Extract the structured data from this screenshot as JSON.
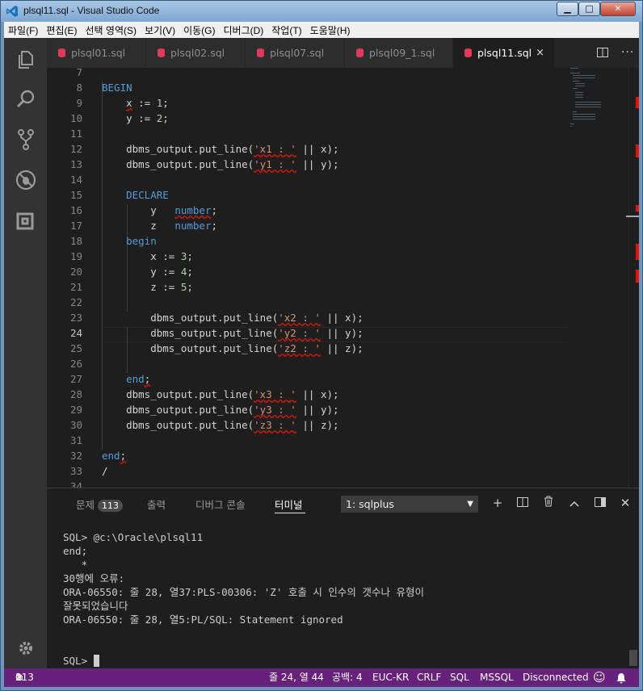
{
  "window": {
    "title": "plsql11.sql - Visual Studio Code",
    "minimize": "▁",
    "maximize": "□",
    "close": "✕"
  },
  "menu": [
    "파일(F)",
    "편집(E)",
    "선택 영역(S)",
    "보기(V)",
    "이동(G)",
    "디버그(D)",
    "작업(T)",
    "도움말(H)"
  ],
  "tabs": [
    {
      "label": "plsql01.sql"
    },
    {
      "label": "plsql02.sql"
    },
    {
      "label": "plsql07.sql"
    },
    {
      "label": "plsql09_1.sql"
    },
    {
      "label": "plsql11.sql",
      "active": true,
      "close": "×"
    }
  ],
  "editor": {
    "current_line": 24,
    "lines": [
      {
        "n": "7",
        "text": ""
      },
      {
        "n": "8",
        "text": "BEGIN"
      },
      {
        "n": "9",
        "text": "    x := 1;"
      },
      {
        "n": "10",
        "text": "    y := 2;"
      },
      {
        "n": "11",
        "text": ""
      },
      {
        "n": "12",
        "text": "    dbms_output.put_line('x1 : ' || x);"
      },
      {
        "n": "13",
        "text": "    dbms_output.put_line('y1 : ' || y);"
      },
      {
        "n": "14",
        "text": ""
      },
      {
        "n": "15",
        "text": "    DECLARE"
      },
      {
        "n": "16",
        "text": "        y   number;"
      },
      {
        "n": "17",
        "text": "        z   number;"
      },
      {
        "n": "18",
        "text": "    begin"
      },
      {
        "n": "19",
        "text": "        x := 3;"
      },
      {
        "n": "20",
        "text": "        y := 4;"
      },
      {
        "n": "21",
        "text": "        z := 5;"
      },
      {
        "n": "22",
        "text": ""
      },
      {
        "n": "23",
        "text": "        dbms_output.put_line('x2 : ' || x);"
      },
      {
        "n": "24",
        "text": "        dbms_output.put_line('y2 : ' || y);"
      },
      {
        "n": "25",
        "text": "        dbms_output.put_line('z2 : ' || z);"
      },
      {
        "n": "26",
        "text": ""
      },
      {
        "n": "27",
        "text": "    end;"
      },
      {
        "n": "28",
        "text": "    dbms_output.put_line('x3 : ' || x);"
      },
      {
        "n": "29",
        "text": "    dbms_output.put_line('y3 : ' || y);"
      },
      {
        "n": "30",
        "text": "    dbms_output.put_line('z3 : ' || z);"
      },
      {
        "n": "31",
        "text": ""
      },
      {
        "n": "32",
        "text": "end;"
      },
      {
        "n": "33",
        "text": "/"
      },
      {
        "n": "34",
        "text": ""
      }
    ]
  },
  "panel": {
    "tabs": {
      "problems": "문제",
      "problems_count": "113",
      "output": "출력",
      "debug_console": "디버그 콘솔",
      "terminal": "터미널"
    },
    "terminal_select": "1: sqlplus",
    "terminal_lines": [
      "SQL> @c:\\Oracle\\plsql11",
      "end;",
      "   *",
      "30행에 오류:",
      "ORA-06550: 줄 28, 열37:PLS-00306: 'Z' 호출 시 인수의 갯수나 유형이",
      "잘못되었습니다",
      "ORA-06550: 줄 28, 열5:PL/SQL: Statement ignored",
      "",
      "",
      "SQL> "
    ]
  },
  "status": {
    "errors": "113",
    "warnings": "0",
    "position": "줄 24, 열 44",
    "spaces": "공백: 4",
    "encoding": "EUC-KR",
    "eol": "CRLF",
    "language": "SQL",
    "dialect": "MSSQL",
    "connection": "Disconnected"
  },
  "colors": {
    "statusbar": "#68217a",
    "activitybar": "#333333",
    "editor_bg": "#1e1e1e",
    "keyword": "#569cd6",
    "string": "#ce9178",
    "number": "#b5cea8",
    "error_squiggle": "#e51400"
  }
}
